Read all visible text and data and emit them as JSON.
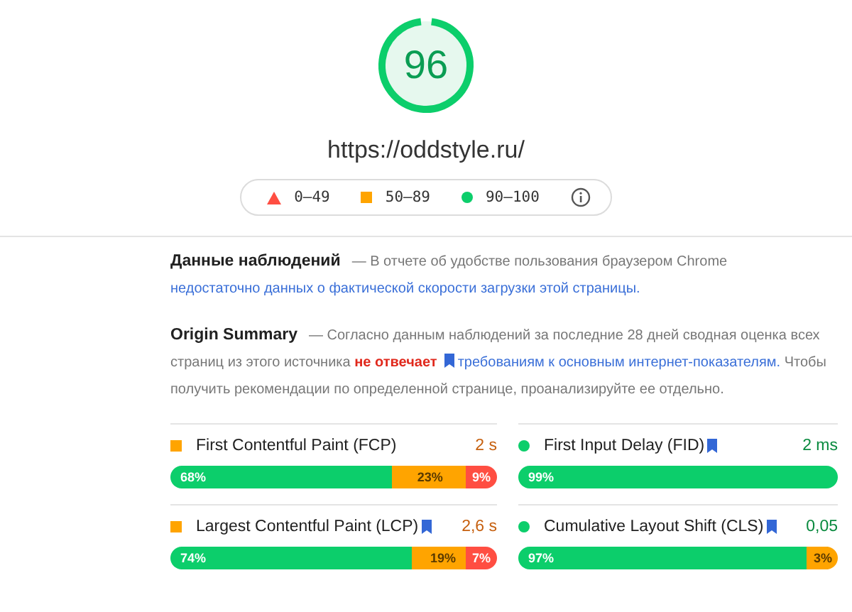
{
  "score": {
    "value": "96",
    "level": 0.96,
    "url": "https://oddstyle.ru/"
  },
  "legend": [
    {
      "kind": "fail",
      "label": "0–49"
    },
    {
      "kind": "average",
      "label": "50–89"
    },
    {
      "kind": "pass",
      "label": "90–100"
    }
  ],
  "sections": [
    {
      "title": "Данные наблюдений",
      "parts": [
        {
          "kind": "plain",
          "text": "— В отчете об удобстве пользования браузером Chrome "
        },
        {
          "kind": "link",
          "text": "недостаточно данных о фактической скорости загрузки этой страницы."
        }
      ]
    },
    {
      "title": "Origin Summary",
      "parts": [
        {
          "kind": "plain",
          "text": "— Согласно данным наблюдений за последние 28 дней сводная оценка всех страниц из этого источника "
        },
        {
          "kind": "fail",
          "text": "не отвечает"
        },
        {
          "kind": "link",
          "text": "требованиям к основным интернет-показателям.",
          "bookmark": true
        },
        {
          "kind": "plain",
          "text": " Чтобы получить рекомендации по определенной странице, проанализируйте ее отдельно."
        }
      ]
    }
  ],
  "metrics": [
    {
      "name": "First Contentful Paint (FCP)",
      "bookmark": false,
      "kind": "average",
      "value": "2 s",
      "distribution": [
        {
          "kind": "good",
          "label": "68%",
          "level": 0.68
        },
        {
          "kind": "average",
          "label": "23%",
          "level": 0.91
        },
        {
          "kind": "poor",
          "label": "9%",
          "level": 1
        }
      ]
    },
    {
      "name": "First Input Delay (FID)",
      "bookmark": true,
      "kind": "good",
      "value": "2 ms",
      "distribution": [
        {
          "kind": "good",
          "label": "99%",
          "level": 1
        }
      ]
    },
    {
      "name": "Largest Contentful Paint (LCP)",
      "bookmark": true,
      "kind": "average",
      "value": "2,6 s",
      "distribution": [
        {
          "kind": "good",
          "label": "74%",
          "level": 0.74
        },
        {
          "kind": "average",
          "label": "19%",
          "level": 0.93
        },
        {
          "kind": "poor",
          "label": "7%",
          "level": 1
        }
      ]
    },
    {
      "name": "Cumulative Layout Shift (CLS)",
      "bookmark": true,
      "kind": "good",
      "value": "0,05",
      "distribution": [
        {
          "kind": "good",
          "label": "97%",
          "level": 0.97
        },
        {
          "kind": "average",
          "label": "3%",
          "level": 1
        }
      ]
    }
  ]
}
